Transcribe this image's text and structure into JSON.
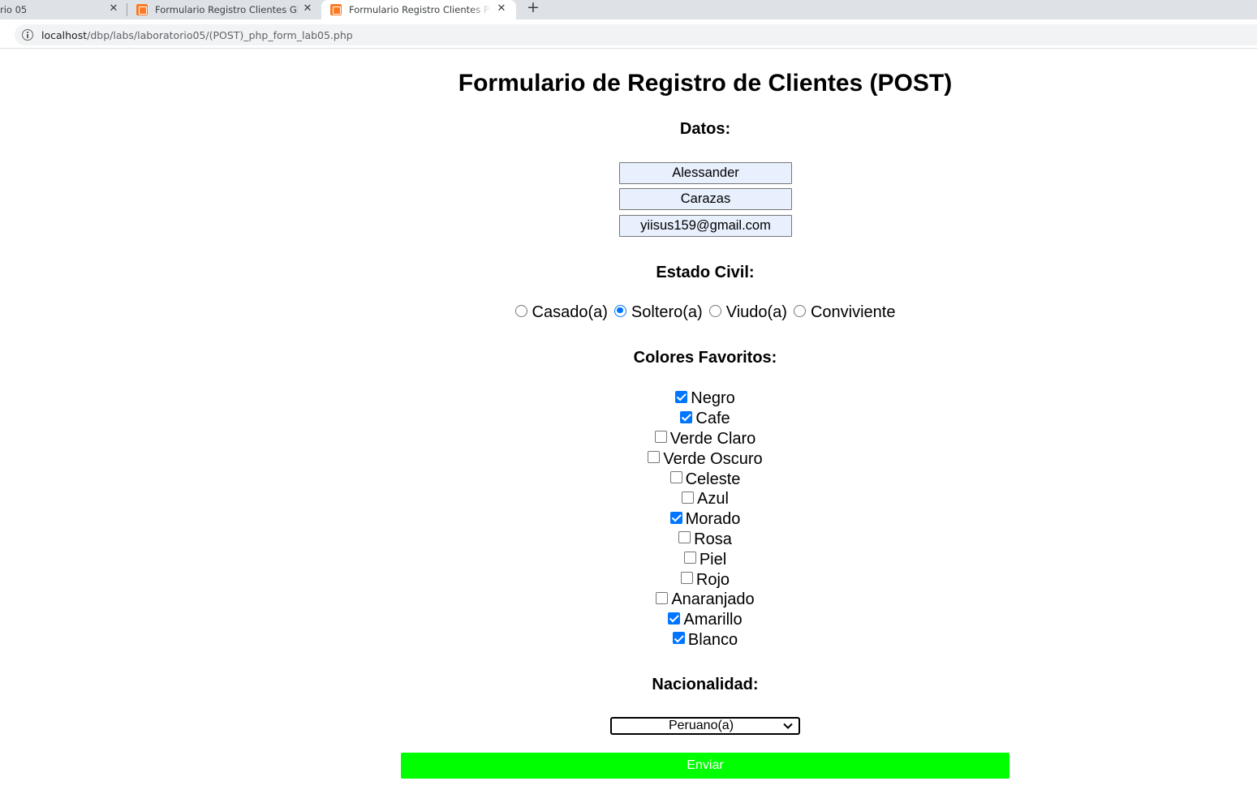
{
  "browser": {
    "tabs": [
      {
        "title": "rio 05"
      },
      {
        "title": "Formulario Registro Clientes GET"
      },
      {
        "title": "Formulario Registro Clientes POS"
      }
    ],
    "url_host": "localhost",
    "url_path": "/dbp/labs/laboratorio05/(POST)_php_form_lab05.php"
  },
  "form": {
    "title": "Formulario de Registro de Clientes (POST)",
    "datos_heading": "Datos:",
    "nombre": "Alessander",
    "apellido": "Carazas",
    "email": "yiisus159@gmail.com",
    "estado_heading": "Estado Civil:",
    "estado_options": [
      {
        "label": "Casado(a)",
        "selected": false
      },
      {
        "label": "Soltero(a)",
        "selected": true
      },
      {
        "label": "Viudo(a)",
        "selected": false
      },
      {
        "label": "Conviviente",
        "selected": false
      }
    ],
    "colores_heading": "Colores Favoritos:",
    "colores": [
      {
        "label": "Negro",
        "checked": true
      },
      {
        "label": "Cafe",
        "checked": true
      },
      {
        "label": "Verde Claro",
        "checked": false
      },
      {
        "label": "Verde Oscuro",
        "checked": false
      },
      {
        "label": "Celeste",
        "checked": false
      },
      {
        "label": "Azul",
        "checked": false
      },
      {
        "label": "Morado",
        "checked": true
      },
      {
        "label": "Rosa",
        "checked": false
      },
      {
        "label": "Piel",
        "checked": false
      },
      {
        "label": "Rojo",
        "checked": false
      },
      {
        "label": "Anaranjado",
        "checked": false
      },
      {
        "label": "Amarillo",
        "checked": true
      },
      {
        "label": "Blanco",
        "checked": true
      }
    ],
    "nacionalidad_heading": "Nacionalidad:",
    "nacionalidad_value": "Peruano(a)",
    "submit_label": "Enviar",
    "submit_color": "#00ff00",
    "input_bg": "#e8f0fe"
  }
}
